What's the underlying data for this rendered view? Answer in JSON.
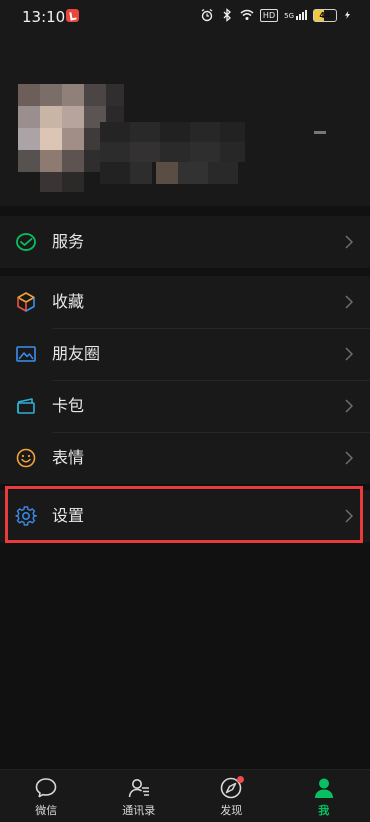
{
  "status_bar": {
    "time": "13:10",
    "battery_level": "44",
    "network_badge": "HD",
    "signal_badge": "5G"
  },
  "menu": {
    "services": {
      "label": "服务",
      "icon": "wechat-pay-check-icon"
    },
    "favorites": {
      "label": "收藏",
      "icon": "cube-icon"
    },
    "moments": {
      "label": "朋友圈",
      "icon": "photo-icon"
    },
    "cards": {
      "label": "卡包",
      "icon": "wallet-card-icon"
    },
    "stickers": {
      "label": "表情",
      "icon": "smiley-icon"
    },
    "settings": {
      "label": "设置",
      "icon": "gear-icon"
    }
  },
  "tabbar": {
    "chats": "微信",
    "contacts": "通讯录",
    "discover": "发现",
    "me": "我"
  },
  "colors": {
    "accent_green": "#07c160",
    "highlight_red": "#e83b3b",
    "badge_red": "#f04a4a"
  }
}
